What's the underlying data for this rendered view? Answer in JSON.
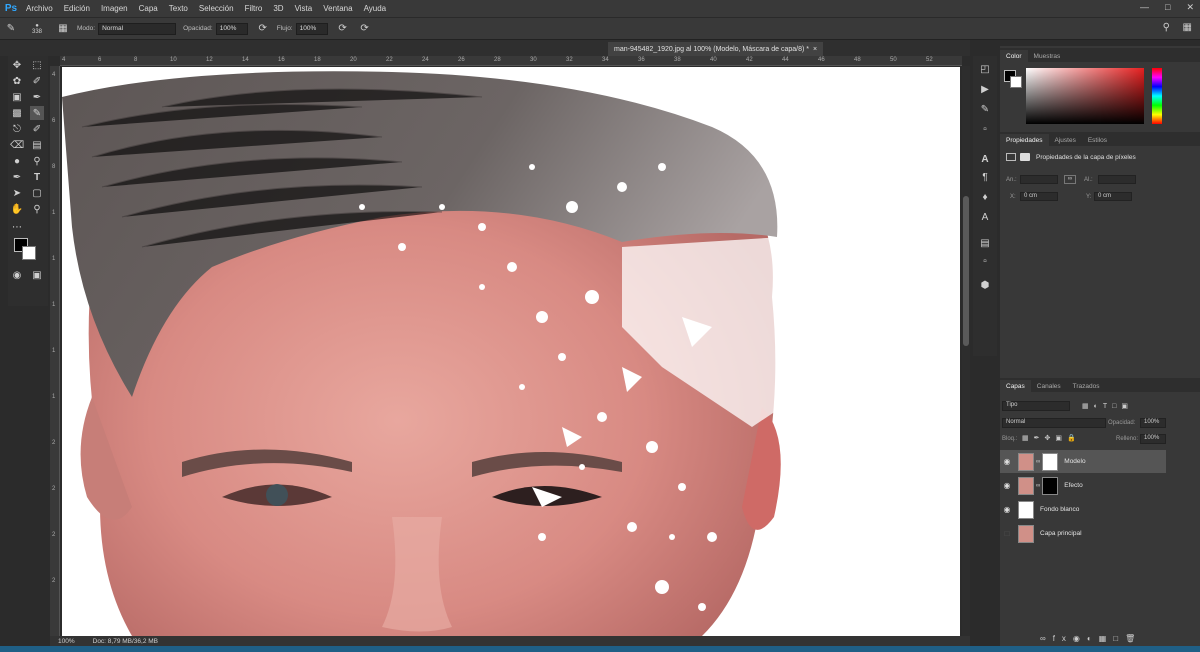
{
  "app": {
    "logo": "Ps",
    "menu": [
      "Archivo",
      "Edición",
      "Imagen",
      "Capa",
      "Texto",
      "Selección",
      "Filtro",
      "3D",
      "Vista",
      "Ventana",
      "Ayuda"
    ]
  },
  "options": {
    "brush_size": "338",
    "mode_label": "Modo:",
    "mode_value": "Normal",
    "opacity_label": "Opacidad:",
    "opacity_value": "100%",
    "flow_label": "Flujo:",
    "flow_value": "100%"
  },
  "document": {
    "tab_title": "man-945482_1920.jpg al 100% (Modelo, Máscara de capa/8) *",
    "zoom": "100%",
    "doc_info": "Doc: 8,79 MB/36,2 MB"
  },
  "rulers": {
    "top": [
      "4",
      "6",
      "8",
      "10",
      "12",
      "14",
      "16",
      "18",
      "20",
      "22",
      "24",
      "26",
      "28",
      "30",
      "32",
      "34",
      "36",
      "38",
      "40",
      "42",
      "44",
      "46",
      "48",
      "50",
      "52"
    ],
    "left": [
      "4",
      "6",
      "8",
      "1",
      "1",
      "1",
      "1",
      "1",
      "2",
      "2",
      "2",
      "2"
    ]
  },
  "color_panel": {
    "tabs": [
      "Color",
      "Muestras"
    ],
    "accent": "#e62020"
  },
  "properties_panel": {
    "tabs": [
      "Propiedades",
      "Ajustes",
      "Estilos"
    ],
    "heading": "Propiedades de la capa de píxeles",
    "an_label": "An.:",
    "al_label": "Al.:",
    "x_label": "X:",
    "x_value": "0 cm",
    "y_label": "Y:",
    "y_value": "0 cm"
  },
  "layers_panel": {
    "tabs": [
      "Capas",
      "Canales",
      "Trazados"
    ],
    "filter_value": "Tipo",
    "blend_mode": "Normal",
    "opacity_label": "Opacidad:",
    "opacity_value": "100%",
    "lock_label": "Bloq.:",
    "fill_label": "Relleno:",
    "fill_value": "100%",
    "layers": [
      {
        "name": "Modelo",
        "visible": true,
        "selected": true
      },
      {
        "name": "Efecto",
        "visible": true,
        "selected": false
      },
      {
        "name": "Fondo blanco",
        "visible": true,
        "selected": false
      },
      {
        "name": "Capa principal",
        "visible": false,
        "selected": false
      }
    ]
  }
}
